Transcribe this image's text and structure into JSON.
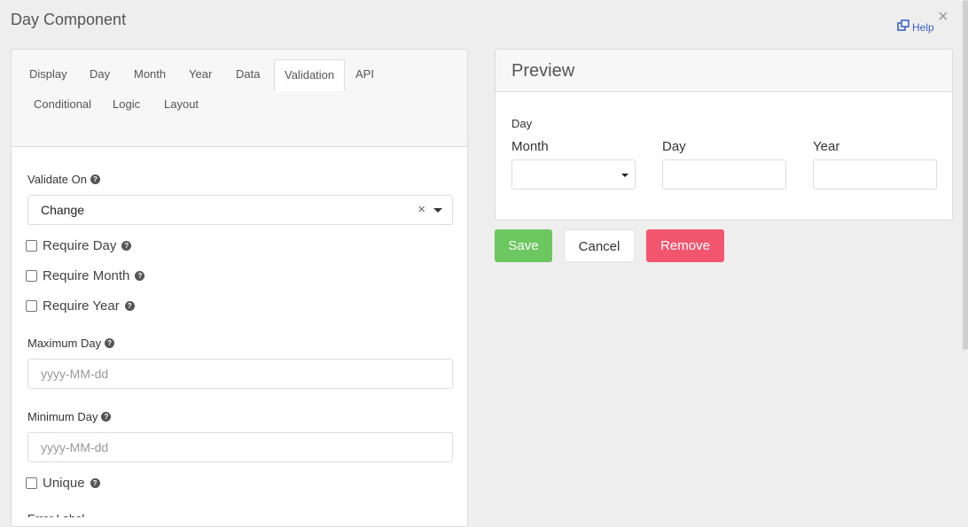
{
  "dialog": {
    "title": "Day Component",
    "help_label": "Help",
    "close_symbol": "×"
  },
  "tabs": [
    "Display",
    "Day",
    "Month",
    "Year",
    "Data",
    "Validation",
    "API",
    "Conditional",
    "Logic",
    "Layout"
  ],
  "active_tab": "Validation",
  "form": {
    "validate_on_label": "Validate On",
    "validate_on_value": "Change",
    "require_day_label": "Require Day",
    "require_month_label": "Require Month",
    "require_year_label": "Require Year",
    "maximum_day_label": "Maximum Day",
    "maximum_day_placeholder": "yyyy-MM-dd",
    "minimum_day_label": "Minimum Day",
    "minimum_day_placeholder": "yyyy-MM-dd",
    "unique_label": "Unique",
    "cut_label": "Error Label"
  },
  "preview": {
    "title": "Preview",
    "group_label": "Day",
    "month_label": "Month",
    "day_label": "Day",
    "year_label": "Year"
  },
  "buttons": {
    "save": "Save",
    "cancel": "Cancel",
    "remove": "Remove"
  },
  "colors": {
    "save": "#6cc760",
    "remove": "#f2566f",
    "link": "#3a63c9"
  },
  "icons": {
    "help": "external-window-icon",
    "close": "close-icon",
    "tooltip": "question-circle-icon",
    "dropdown": "caret-down-icon",
    "clear": "clear-x-icon"
  }
}
